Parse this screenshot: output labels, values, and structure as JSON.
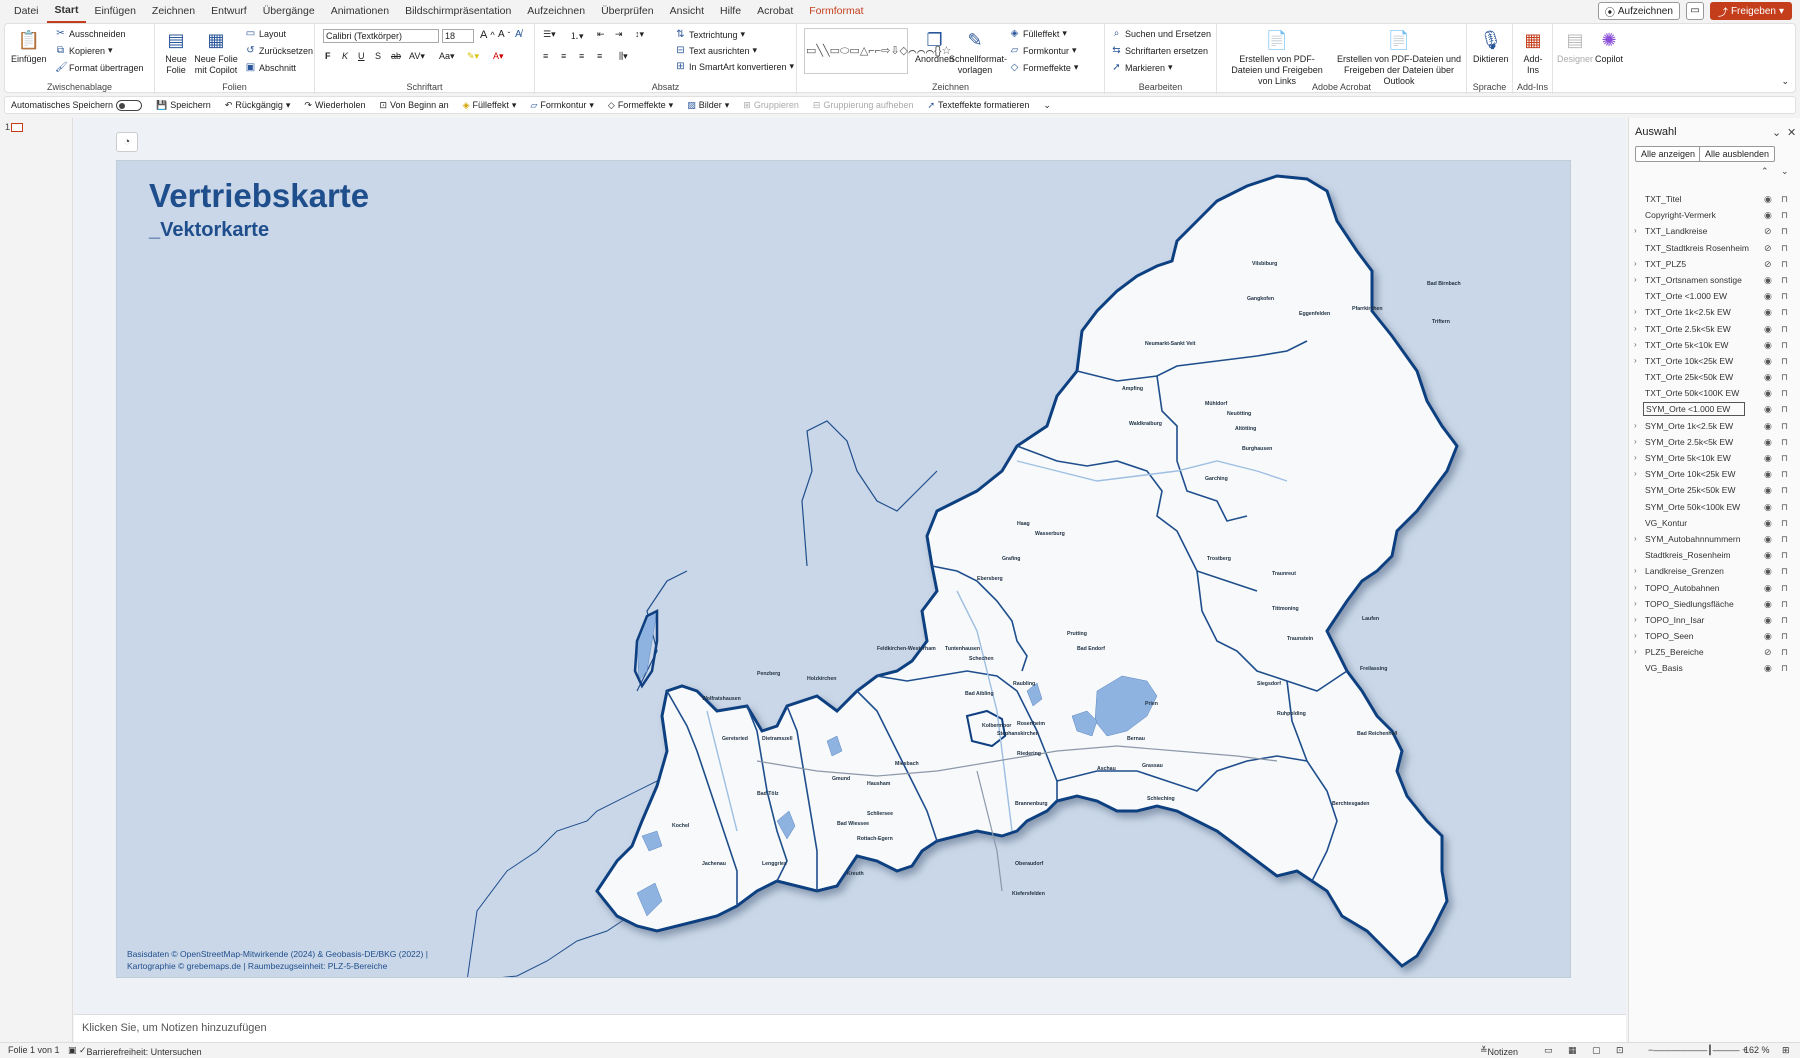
{
  "menu": {
    "items": [
      "Datei",
      "Start",
      "Einfügen",
      "Zeichnen",
      "Entwurf",
      "Übergänge",
      "Animationen",
      "Bildschirmpräsentation",
      "Aufzeichnen",
      "Überprüfen",
      "Ansicht",
      "Hilfe",
      "Acrobat",
      "Formformat"
    ],
    "active": "Start",
    "record_label": "Aufzeichnen",
    "share_label": "Freigeben"
  },
  "ribbon": {
    "clipboard": {
      "paste": "Einfügen",
      "cut": "Ausschneiden",
      "copy": "Kopieren",
      "format": "Format übertragen",
      "label": "Zwischenablage"
    },
    "slides": {
      "new": "Neue Folie",
      "new_copilot": "Neue Folie mit Copilot",
      "layout": "Layout",
      "reset": "Zurücksetzen",
      "section": "Abschnitt",
      "label": "Folien"
    },
    "font": {
      "name": "Calibri (Textkörper)",
      "size": "18",
      "label": "Schriftart"
    },
    "paragraph": {
      "direction": "Textrichtung",
      "align": "Text ausrichten",
      "smartart": "In SmartArt konvertieren",
      "label": "Absatz"
    },
    "drawing": {
      "arrange": "Anordnen",
      "quick": "Schnellformat-vorlagen",
      "fill": "Fülleffekt",
      "outline": "Formkontur",
      "effects": "Formeffekte",
      "label": "Zeichnen"
    },
    "editing": {
      "find": "Suchen und Ersetzen",
      "replace": "Schriftarten ersetzen",
      "select": "Markieren",
      "label": "Bearbeiten"
    },
    "acrobat": {
      "pdf_links": "Erstellen von PDF-Dateien und Freigeben von Links",
      "pdf_outlook": "Erstellen von PDF-Dateien und Freigeben der Dateien über Outlook",
      "label": "Adobe Acrobat"
    },
    "voice": {
      "dictate": "Diktieren",
      "label": "Sprache"
    },
    "addins": {
      "addins": "Add-Ins",
      "label": "Add-Ins"
    },
    "designer": "Designer",
    "copilot": "Copilot"
  },
  "qat": {
    "autosave": "Automatisches Speichern",
    "save": "Speichern",
    "undo": "Rückgängig",
    "redo": "Wiederholen",
    "from_start": "Von Beginn an",
    "fill": "Fülleffekt",
    "outline": "Formkontur",
    "effects": "Formeffekte",
    "pictures": "Bilder",
    "group": "Gruppieren",
    "ungroup": "Gruppierung aufheben",
    "text_effects": "Texteffekte formatieren"
  },
  "slide": {
    "number": "1",
    "title": "Vertriebskarte",
    "subtitle": "_Vektorkarte",
    "credit_line1": "Basisdaten © OpenStreetMap-Mitwirkende (2024)  & Geobasis-DE/BKG (2022)  |",
    "credit_line2": "Kartographie © grebemaps.de  |  Raumbezugseinheit: PLZ-5-Bereiche",
    "places": [
      "Vilsbiburg",
      "Gangkofen",
      "Eggenfelden",
      "Pfarrkirchen",
      "Bad Birnbach",
      "Triftern",
      "Neumarkt-Sankt Veit",
      "Mühldorf",
      "Neuötting",
      "Altötting",
      "Burghausen",
      "Garching",
      "Trostberg",
      "Traunreut",
      "Tittmoning",
      "Laufen",
      "Freilassing",
      "Bad Reichenhall",
      "Berchtesgaden",
      "Traunstein",
      "Wasserburg",
      "Haag",
      "Ampfing",
      "Waldkraiburg",
      "Ebersberg",
      "Grafing",
      "Rosenheim",
      "Kolbermoor",
      "Bad Aibling",
      "Prien",
      "Bernau",
      "Grassau",
      "Siegsdorf",
      "Ruhpolding",
      "Schleching",
      "Aschau",
      "Brannenburg",
      "Oberaudorf",
      "Kiefersfelden",
      "Miesbach",
      "Hausham",
      "Schliersee",
      "Holzkirchen",
      "Wolfratshausen",
      "Geretsried",
      "Dietramszell",
      "Bad Tölz",
      "Lenggries",
      "Gmund",
      "Bad Wiessee",
      "Rottach-Egern",
      "Kreuth",
      "Kochel",
      "Jachenau",
      "Penzberg",
      "Feldkirchen-Westerham",
      "Tuntenhausen",
      "Schechen",
      "Raubling",
      "Stephanskirchen",
      "Riedering",
      "Bad Endorf",
      "Prutting"
    ],
    "accessibility_icon": "accessibility-icon"
  },
  "notes_placeholder": "Klicken Sie, um Notizen hinzuzufügen",
  "selection_pane": {
    "title": "Auswahl",
    "show_all": "Alle anzeigen",
    "hide_all": "Alle ausblenden",
    "items": [
      {
        "name": "TXT_Titel",
        "expand": false,
        "hidden": false
      },
      {
        "name": "Copyright-Vermerk",
        "expand": false,
        "hidden": false
      },
      {
        "name": "TXT_Landkreise",
        "expand": true,
        "hidden": true
      },
      {
        "name": "TXT_Stadtkreis Rosenheim",
        "expand": false,
        "hidden": true
      },
      {
        "name": "TXT_PLZ5",
        "expand": true,
        "hidden": true
      },
      {
        "name": "TXT_Ortsnamen sonstige",
        "expand": true,
        "hidden": false
      },
      {
        "name": "TXT_Orte <1.000 EW",
        "expand": false,
        "hidden": false
      },
      {
        "name": "TXT_Orte 1k<2.5k EW",
        "expand": true,
        "hidden": false
      },
      {
        "name": "TXT_Orte 2.5k<5k EW",
        "expand": true,
        "hidden": false
      },
      {
        "name": "TXT_Orte 5k<10k EW",
        "expand": true,
        "hidden": false
      },
      {
        "name": "TXT_Orte 10k<25k EW",
        "expand": true,
        "hidden": false
      },
      {
        "name": "TXT_Orte 25k<50k EW",
        "expand": false,
        "hidden": false
      },
      {
        "name": "TXT_Orte 50k<100K EW",
        "expand": false,
        "hidden": false
      },
      {
        "name": "SYM_Orte <1.000 EW",
        "expand": false,
        "hidden": false,
        "selected": true
      },
      {
        "name": "SYM_Orte 1k<2.5k EW",
        "expand": true,
        "hidden": false
      },
      {
        "name": "SYM_Orte 2.5k<5k EW",
        "expand": true,
        "hidden": false
      },
      {
        "name": "SYM_Orte 5k<10k EW",
        "expand": true,
        "hidden": false
      },
      {
        "name": "SYM_Orte 10k<25k EW",
        "expand": true,
        "hidden": false
      },
      {
        "name": "SYM_Orte 25k<50k EW",
        "expand": false,
        "hidden": false
      },
      {
        "name": "SYM_Orte 50k<100k EW",
        "expand": false,
        "hidden": false
      },
      {
        "name": "VG_Kontur",
        "expand": false,
        "hidden": false
      },
      {
        "name": "SYM_Autobahnnummern",
        "expand": true,
        "hidden": false
      },
      {
        "name": "Stadtkreis_Rosenheim",
        "expand": false,
        "hidden": false
      },
      {
        "name": "Landkreise_Grenzen",
        "expand": true,
        "hidden": false
      },
      {
        "name": "TOPO_Autobahnen",
        "expand": true,
        "hidden": false
      },
      {
        "name": "TOPO_Siedlungsfläche",
        "expand": true,
        "hidden": false
      },
      {
        "name": "TOPO_Inn_Isar",
        "expand": true,
        "hidden": false
      },
      {
        "name": "TOPO_Seen",
        "expand": true,
        "hidden": false
      },
      {
        "name": "PLZ5_Bereiche",
        "expand": true,
        "hidden": true
      },
      {
        "name": "VG_Basis",
        "expand": false,
        "hidden": false
      }
    ]
  },
  "status": {
    "slide_info": "Folie 1 von 1",
    "accessibility": "Barrierefreiheit: Untersuchen",
    "notes": "Notizen",
    "zoom": "162 %"
  },
  "colors": {
    "accent": "#c43e1c",
    "map_blue": "#1f4e8c",
    "slide_bg": "#cad7e8"
  }
}
